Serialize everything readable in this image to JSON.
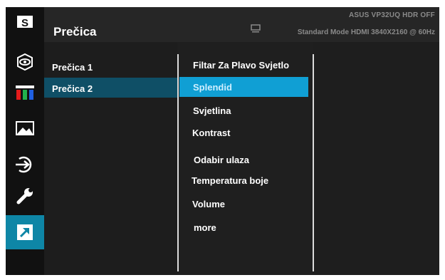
{
  "header": {
    "title": "Prečica",
    "model": "ASUS  VP32UQ  HDR OFF",
    "mode": "Standard Mode HDMI 3840X2160 @ 60Hz"
  },
  "sidebar": {
    "items": [
      {
        "name": "splendid",
        "icon": "s-box-icon"
      },
      {
        "name": "blue-light-filter",
        "icon": "eye-icon"
      },
      {
        "name": "color",
        "icon": "color-bars-icon"
      },
      {
        "name": "image",
        "icon": "landscape-image-icon"
      },
      {
        "name": "input-select",
        "icon": "input-arrow-icon"
      },
      {
        "name": "system-setup",
        "icon": "wrench-icon"
      },
      {
        "name": "shortcut",
        "icon": "shortcut-arrow-icon",
        "active": true
      }
    ]
  },
  "menu": {
    "col1": [
      "Prečica 1",
      "Prečica 2"
    ],
    "col1_selected": "Prečica 2",
    "col2": [
      "Filtar Za Plavo Svjetlo",
      "Splendid",
      "Svjetlina",
      "Kontrast",
      "Odabir ulaza",
      "Temperatura boje",
      "Volume",
      "more"
    ],
    "col2_selected": "Splendid"
  },
  "colors": {
    "accent": "#0e86a6",
    "selection_bright": "#109fd4",
    "selection_dark": "#0f4f66",
    "background": "#1b1b1b"
  }
}
